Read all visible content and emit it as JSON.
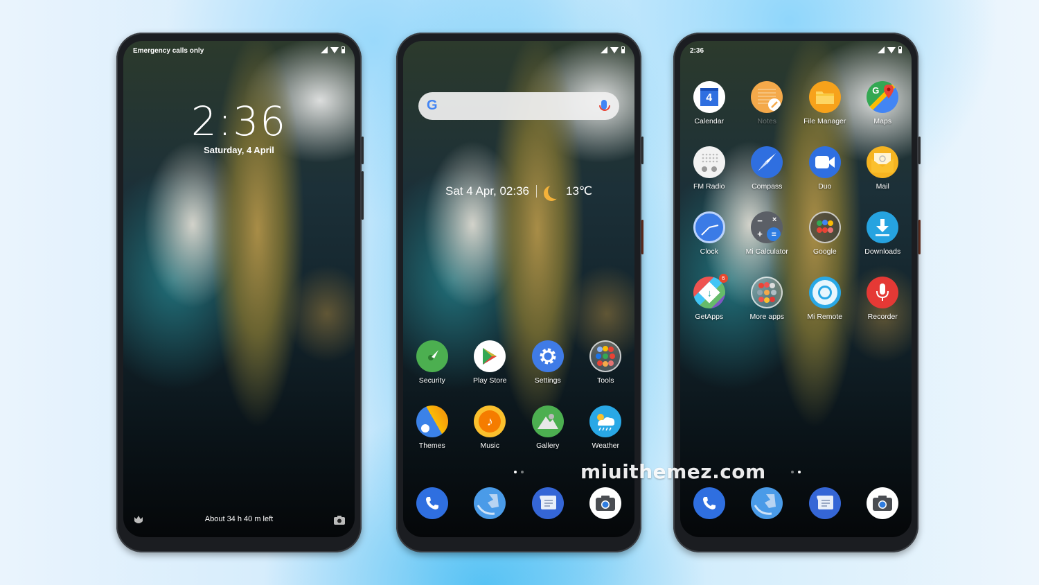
{
  "watermark": "miuithemez.com",
  "lock_screen": {
    "status_left": "Emergency calls only",
    "clock": "2:36",
    "date": "Saturday, 4 April",
    "battery_text": "About 34 h 40 m left",
    "left_icon": "flower-icon",
    "right_icon": "camera-icon"
  },
  "home_screen": {
    "search_placeholder": "",
    "search_logo": "G",
    "widget": {
      "datetime": "Sat 4 Apr, 02:36",
      "weather_icon": "moon-icon",
      "temperature": "13℃"
    },
    "apps": [
      {
        "label": "Security",
        "icon": "security-icon",
        "color": "#4caf50"
      },
      {
        "label": "Play Store",
        "icon": "play-store-icon",
        "color": "#ffffff"
      },
      {
        "label": "Settings",
        "icon": "gear-icon",
        "color": "#3f7be6"
      },
      {
        "label": "Tools",
        "icon": "folder-icon",
        "color": "rgba(255,255,255,0.25)"
      },
      {
        "label": "Themes",
        "icon": "themes-icon",
        "color": "#3b82e8"
      },
      {
        "label": "Music",
        "icon": "music-note-icon",
        "color": "#f9a825"
      },
      {
        "label": "Gallery",
        "icon": "mountain-icon",
        "color": "#4caf50"
      },
      {
        "label": "Weather",
        "icon": "weather-cloud-icon",
        "color": "#29a8e6"
      }
    ],
    "pages": {
      "current": 1,
      "total": 2
    }
  },
  "drawer_screen": {
    "status_time": "2:36",
    "apps": [
      {
        "label": "Calendar",
        "icon": "calendar-icon",
        "color": "#ffffff",
        "glyph": "4"
      },
      {
        "label": "Notes",
        "icon": "notes-icon",
        "color": "#f4a94a"
      },
      {
        "label": "File Manager",
        "icon": "folder-icon",
        "color": "#f7a21b"
      },
      {
        "label": "Maps",
        "icon": "maps-icon",
        "color": "#34a853"
      },
      {
        "label": "FM Radio",
        "icon": "radio-icon",
        "color": "#f2f2f2"
      },
      {
        "label": "Compass",
        "icon": "compass-icon",
        "color": "#2f6fe0"
      },
      {
        "label": "Duo",
        "icon": "video-camera-icon",
        "color": "#2f6fe0"
      },
      {
        "label": "Mail",
        "icon": "mail-icon",
        "color": "#f6b421"
      },
      {
        "label": "Clock",
        "icon": "clock-icon",
        "color": "#3b7be6"
      },
      {
        "label": "Mi Calculator",
        "icon": "calculator-icon",
        "color": "#5b5f66"
      },
      {
        "label": "Google",
        "icon": "folder-icon",
        "color": "rgba(60,60,60,0.7)"
      },
      {
        "label": "Downloads",
        "icon": "download-icon",
        "color": "#26a3e0"
      },
      {
        "label": "GetApps",
        "icon": "getapps-icon",
        "color": "#ffffff",
        "badge": "6"
      },
      {
        "label": "More apps",
        "icon": "folder-icon",
        "color": "rgba(255,255,255,0.25)"
      },
      {
        "label": "Mi Remote",
        "icon": "remote-icon",
        "color": "#29a8e6"
      },
      {
        "label": "Recorder",
        "icon": "microphone-icon",
        "color": "#e53935"
      }
    ],
    "pages": {
      "current": 2,
      "total": 2
    }
  },
  "dock": [
    {
      "name": "Phone",
      "icon": "phone-icon",
      "color": "#2f6fe0"
    },
    {
      "name": "Browser",
      "icon": "browser-globe-icon",
      "color": "#4a9be8"
    },
    {
      "name": "Messages",
      "icon": "message-icon",
      "color": "#3566d6"
    },
    {
      "name": "Camera",
      "icon": "camera-icon",
      "color": "#ffffff"
    }
  ]
}
